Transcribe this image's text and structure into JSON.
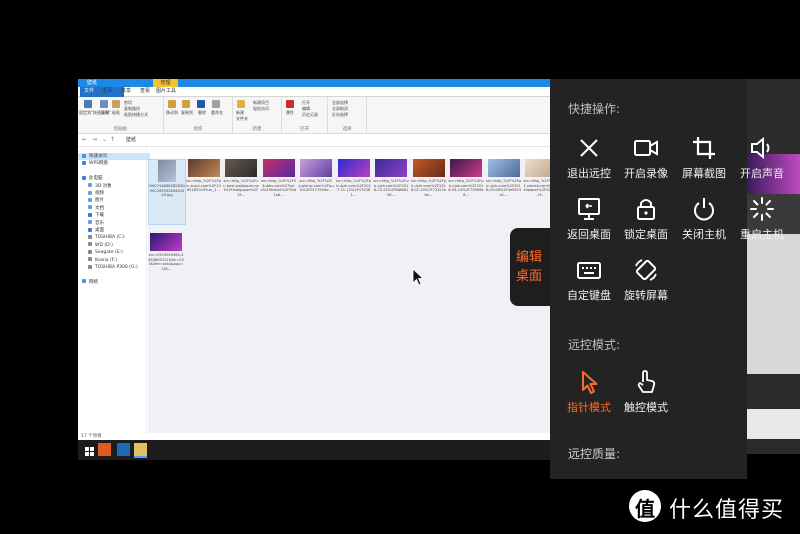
{
  "explorer": {
    "title": "壁纸",
    "context_tab": "管理",
    "ribbon_tabs": [
      "文件",
      "主页",
      "共享",
      "查看",
      "图片工具"
    ],
    "groups": [
      "剪贴板",
      "组织",
      "新建",
      "打开",
      "选择"
    ],
    "ribbon_labels": {
      "pin": "固定到\"快速访问\"",
      "copy": "复制",
      "paste": "粘贴",
      "cut": "剪切",
      "copy_path": "复制路径",
      "paste_shortcut": "粘贴快捷方式",
      "move_to": "移动到",
      "copy_to": "复制到",
      "delete": "删除",
      "rename": "重命名",
      "new_folder": "新建\n文件夹",
      "new_item": "新建项目",
      "easy_access": "轻松访问",
      "properties": "属性",
      "open": "打开",
      "edit": "编辑",
      "history": "历史记录",
      "select_all": "全部选择",
      "select_none": "全部取消",
      "invert_selection": "反向选择"
    },
    "breadcrumb": "壁纸",
    "nav": [
      {
        "label": "快速访问",
        "color": "#4a90d9",
        "selected": true
      },
      {
        "label": "WPS网盘",
        "color": "#3b82f6"
      },
      {
        "label": "",
        "color": "transparent"
      },
      {
        "label": "此电脑",
        "color": "#3a7bd5"
      },
      {
        "label": "3D 对象",
        "color": "#6aa0e0"
      },
      {
        "label": "视频",
        "color": "#6aa0e0"
      },
      {
        "label": "图片",
        "color": "#6aa0e0"
      },
      {
        "label": "文档",
        "color": "#6aa0e0"
      },
      {
        "label": "下载",
        "color": "#2f7bd9"
      },
      {
        "label": "音乐",
        "color": "#6aa0e0"
      },
      {
        "label": "桌面",
        "color": "#3a7bd5"
      },
      {
        "label": "TOSHIBA (C:)",
        "color": "#888"
      },
      {
        "label": "WD (D:)",
        "color": "#888"
      },
      {
        "label": "Seagate (E:)",
        "color": "#888"
      },
      {
        "label": "Kioxia (F:)",
        "color": "#888"
      },
      {
        "label": "TOSHIBA P300 (G:)",
        "color": "#888"
      },
      {
        "label": "",
        "color": "transparent"
      },
      {
        "label": "网络",
        "color": "#4a90d9"
      }
    ],
    "files": [
      {
        "name": "D0074A8804B283D90C26593284444343.jpg",
        "colors": [
          "#7c8aa0",
          "#b8c4d6"
        ],
        "selected": true
      },
      {
        "name": "src=http_%2F%2Fpic.zcool.com%2F1365183%2Fhxc_1...",
        "colors": [
          "#5a3a2a",
          "#c48a5a"
        ]
      },
      {
        "name": "src=http_%2F%2Fcn.best-wallpaper.net%2Fwallpaper%2F19...",
        "colors": [
          "#6a5a50",
          "#2a2a2a"
        ]
      },
      {
        "name": "src=http_%2F%2F03ubbs.com%2Fpics%2Farticle%2F00d1a8...",
        "colors": [
          "#c0306a",
          "#5a2aa0"
        ]
      },
      {
        "name": "src=http_%2F%2Fg.phinsj.com%2Fpub%2F0177904e...",
        "colors": [
          "#c8a0e0",
          "#6040a0"
        ]
      },
      {
        "name": "src=http_%2F%2Fpic.zjzh.com%2F2017-11-12%2F475381...",
        "colors": [
          "#2a2ad0",
          "#c040c0"
        ]
      },
      {
        "name": "src=http_%2F%2Fpic.zjzh.com%2F2018-03-22%2F8dfb8158...",
        "colors": [
          "#3a2a90",
          "#9040d0"
        ]
      },
      {
        "name": "src=http_%2F%2Fpic.zjzh.com%2F2018-07-10%2F72322ebe...",
        "colors": [
          "#c05a2a",
          "#6a2a1a"
        ]
      },
      {
        "name": "src=http_%2F%2Fpic.zjzh.com%2F2018-04-14%2F70906e8...",
        "colors": [
          "#3a1a4a",
          "#d03a8a"
        ]
      },
      {
        "name": "src=http_%2F%2Fpic.zjzh.com%2F2018-03-06%2F4e5674a1...",
        "colors": [
          "#a0c0e0",
          "#4a6aa0"
        ]
      },
      {
        "name": "src=http_%2F%2Fc1.sdnlab.com%2Fwallpaper%2F2020%2F...",
        "colors": [
          "#e8e0d0",
          "#c0a080"
        ]
      },
      {
        "name": "src=2593040984,4083809121&fm=253&fmt=auto&app=138...",
        "colors": [
          "#2a1a6a",
          "#c03ad0"
        ]
      }
    ],
    "status": "17 个项目"
  },
  "panel": {
    "quick_title": "快捷操作:",
    "quick_actions": [
      {
        "label": "退出远控",
        "icon": "close-icon"
      },
      {
        "label": "开启录像",
        "icon": "video-camera-icon"
      },
      {
        "label": "屏幕截图",
        "icon": "crop-icon"
      },
      {
        "label": "开启声音",
        "icon": "speaker-icon"
      },
      {
        "label": "返回桌面",
        "icon": "desktop-icon"
      },
      {
        "label": "锁定桌面",
        "icon": "lock-icon"
      },
      {
        "label": "关闭主机",
        "icon": "power-icon"
      },
      {
        "label": "重启主机",
        "icon": "restart-spinner-icon"
      },
      {
        "label": "自定键盘",
        "icon": "keyboard-icon"
      },
      {
        "label": "旋转屏幕",
        "icon": "rotate-screen-icon"
      }
    ],
    "mode_title": "远控模式:",
    "modes": [
      {
        "label": "指针模式",
        "icon": "pointer-icon",
        "active": true
      },
      {
        "label": "触控模式",
        "icon": "touch-icon",
        "active": false
      }
    ],
    "quality_title": "远控质量:",
    "edit_desktop": "编辑\n桌面",
    "accent_color": "#ff6a2a"
  },
  "watermark": {
    "logo_letter": "值",
    "text": "什么值得买"
  }
}
